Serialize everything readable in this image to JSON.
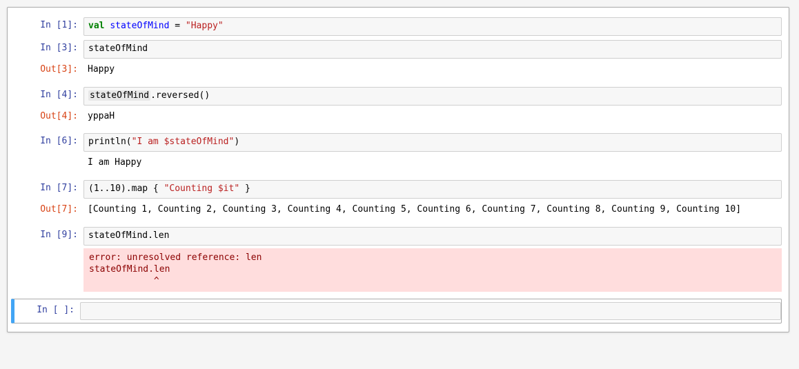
{
  "cells": [
    {
      "type": "code",
      "prompt_in": "In [1]:",
      "code_tokens": [
        {
          "t": "val ",
          "cls": "tok-keyword"
        },
        {
          "t": "stateOfMind",
          "cls": "tok-ident"
        },
        {
          "t": " = ",
          "cls": "tok-name"
        },
        {
          "t": "\"Happy\"",
          "cls": "tok-string"
        }
      ]
    },
    {
      "type": "code",
      "prompt_in": "In [3]:",
      "code_tokens": [
        {
          "t": "stateOfMind",
          "cls": "tok-name"
        }
      ],
      "out_prompt": "Out[3]:",
      "out_text": "Happy"
    },
    {
      "type": "code",
      "prompt_in": "In [4]:",
      "code_tokens": [
        {
          "t": "stateOfMind",
          "cls": "tok-hl"
        },
        {
          "t": ".reversed()",
          "cls": "tok-name"
        }
      ],
      "out_prompt": "Out[4]:",
      "out_text": "yppaH"
    },
    {
      "type": "code",
      "prompt_in": "In [6]:",
      "code_tokens": [
        {
          "t": "println(",
          "cls": "tok-name"
        },
        {
          "t": "\"I am $stateOfMind\"",
          "cls": "tok-string"
        },
        {
          "t": ")",
          "cls": "tok-name"
        }
      ],
      "stdout": "I am Happy"
    },
    {
      "type": "code",
      "prompt_in": "In [7]:",
      "code_tokens": [
        {
          "t": "(1..10).map { ",
          "cls": "tok-name"
        },
        {
          "t": "\"Counting $it\"",
          "cls": "tok-string"
        },
        {
          "t": " }",
          "cls": "tok-name"
        }
      ],
      "out_prompt": "Out[7]:",
      "out_text": "[Counting 1, Counting 2, Counting 3, Counting 4, Counting 5, Counting 6, Counting 7, Counting 8, Counting 9, Counting 10]"
    },
    {
      "type": "code",
      "prompt_in": "In [9]:",
      "code_tokens": [
        {
          "t": "stateOfMind.len",
          "cls": "tok-name"
        }
      ],
      "error": "error: unresolved reference: len\nstateOfMind.len\n            ^"
    },
    {
      "type": "empty",
      "prompt_in": "In [ ]:"
    }
  ]
}
